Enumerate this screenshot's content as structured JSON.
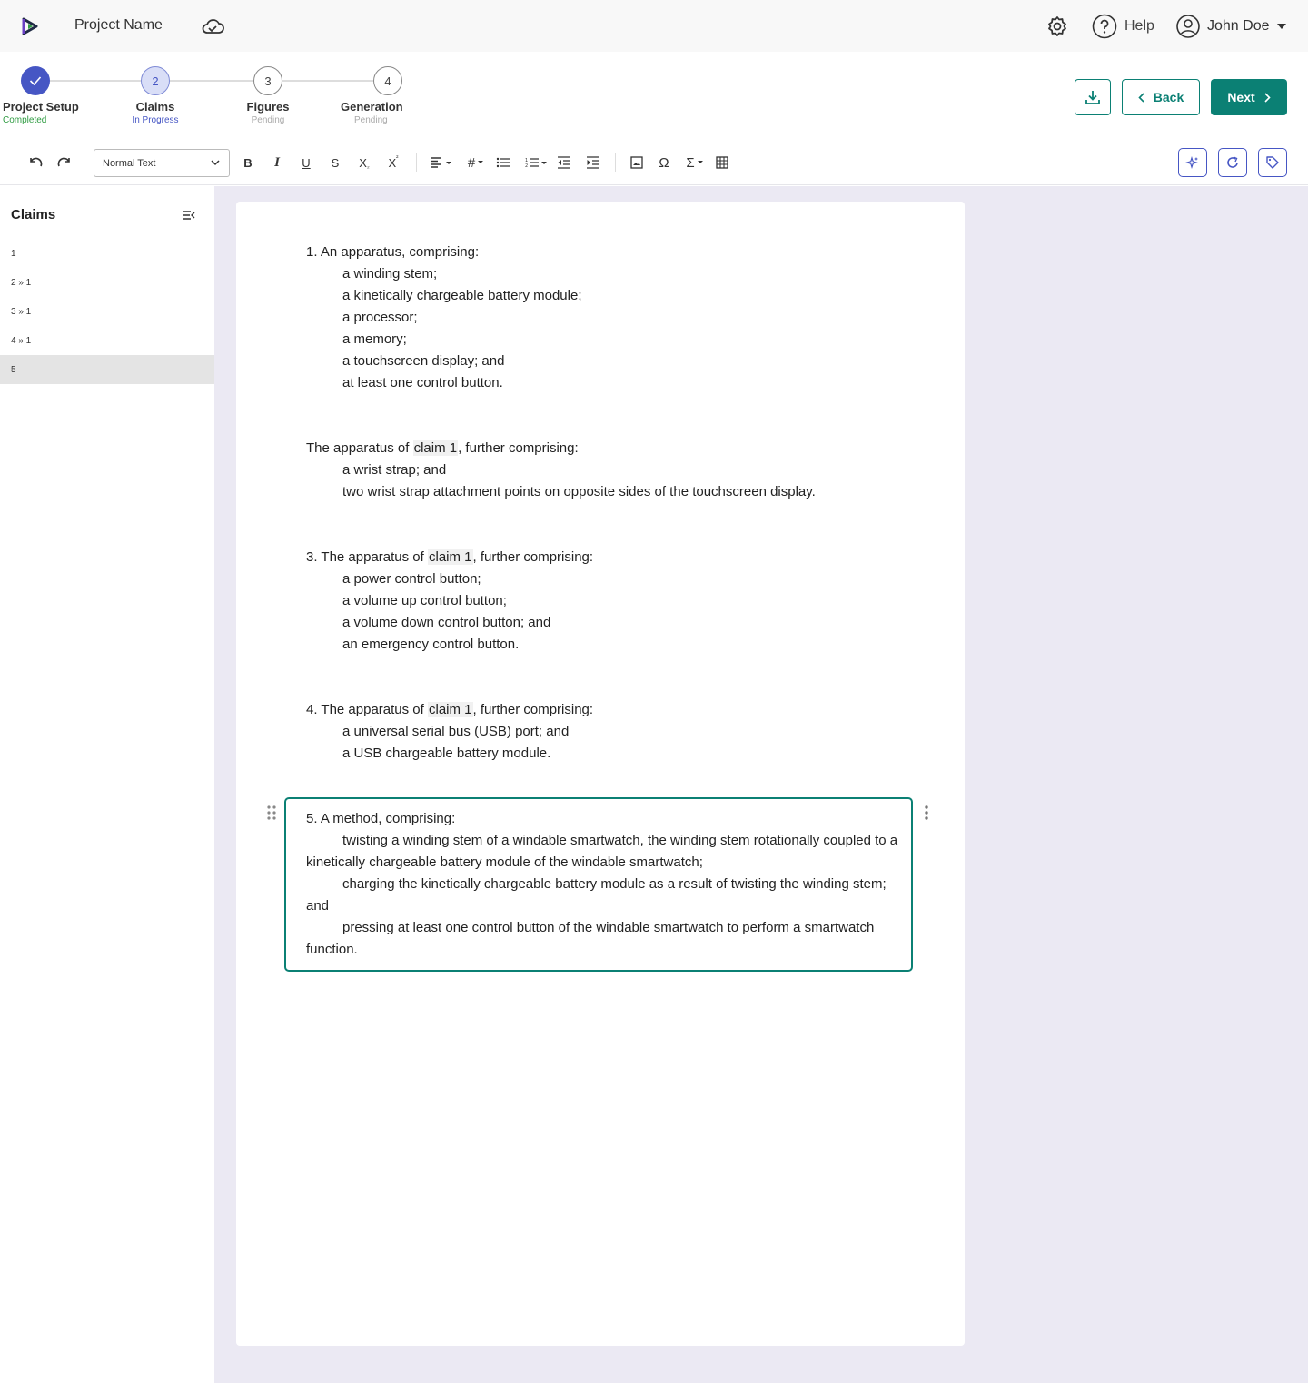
{
  "header": {
    "project_name": "Project Name",
    "help_label": "Help",
    "user_name": "John Doe"
  },
  "stepper": {
    "steps": [
      {
        "number": "1",
        "label": "Project Setup",
        "status": "Completed"
      },
      {
        "number": "2",
        "label": "Claims",
        "status": "In Progress"
      },
      {
        "number": "3",
        "label": "Figures",
        "status": "Pending"
      },
      {
        "number": "4",
        "label": "Generation",
        "status": "Pending"
      }
    ],
    "back_label": "Back",
    "next_label": "Next"
  },
  "toolbar": {
    "text_style": "Normal Text"
  },
  "sidebar": {
    "title": "Claims",
    "items": [
      "1",
      "2 » 1",
      "3 » 1",
      "4 » 1",
      "5"
    ],
    "active_index": 4
  },
  "claims": [
    {
      "head_pre": "1. An apparatus, comprising:",
      "head_ref": "",
      "head_post": "",
      "elements": [
        "a winding stem;",
        "a kinetically chargeable battery module;",
        "a processor;",
        "a memory;",
        "a touchscreen display; and",
        "at least one control button."
      ]
    },
    {
      "head_pre": "The apparatus of ",
      "head_ref": "claim 1",
      "head_post": ", further comprising:",
      "elements": [
        "a wrist strap; and",
        "two wrist strap attachment points on opposite sides of the touchscreen display."
      ]
    },
    {
      "head_pre": "3. The apparatus of ",
      "head_ref": "claim 1",
      "head_post": ", further comprising:",
      "elements": [
        "a power control button;",
        "a volume up control button;",
        "a volume down control button; and",
        "an emergency control button."
      ]
    },
    {
      "head_pre": "4. The apparatus of ",
      "head_ref": "claim 1",
      "head_post": ", further comprising:",
      "elements": [
        "a universal serial bus (USB) port; and",
        "a USB chargeable battery module."
      ]
    }
  ],
  "claim5": {
    "head": "5. A method, comprising:",
    "elements": [
      "twisting a winding stem of a windable smartwatch, the winding stem rotationally coupled to a kinetically chargeable battery module of the windable smartwatch;",
      "charging the kinetically chargeable battery module as a result of twisting the winding stem; and",
      "pressing at least one control button of the windable smartwatch to perform a smartwatch function."
    ]
  },
  "colors": {
    "accent": "#0b8074",
    "step_blue": "#4656c4",
    "canvas_bg": "#ebe9f3"
  }
}
